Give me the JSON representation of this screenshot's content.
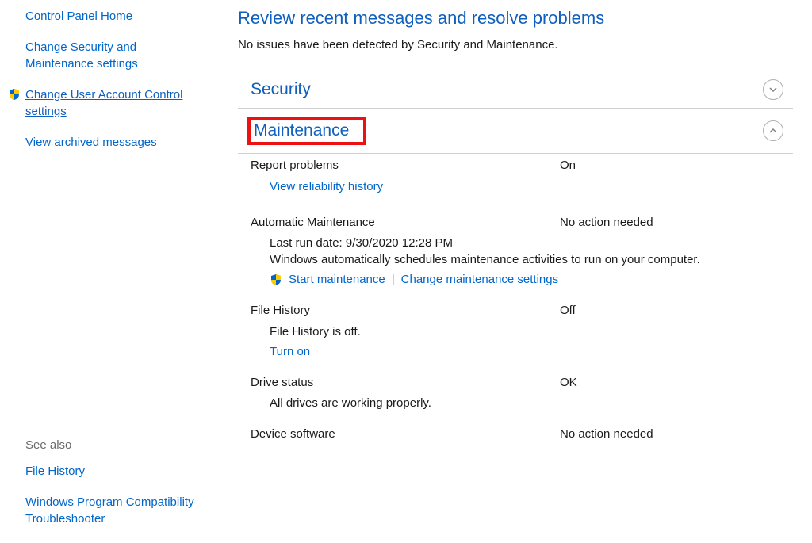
{
  "sidebar": {
    "home": "Control Panel Home",
    "change_security": "Change Security and Maintenance settings",
    "change_uac": "Change User Account Control settings",
    "view_archived": "View archived messages",
    "see_also": "See also",
    "file_history": "File History",
    "compat_troubleshooter": "Windows Program Compatibility Troubleshooter"
  },
  "main": {
    "title": "Review recent messages and resolve problems",
    "subtitle": "No issues have been detected by Security and Maintenance.",
    "security_section": "Security",
    "maintenance_section": "Maintenance",
    "report_problems": {
      "label": "Report problems",
      "value": "On",
      "link": "View reliability history"
    },
    "auto_maint": {
      "label": "Automatic Maintenance",
      "value": "No action needed",
      "last_run": "Last run date: 9/30/2020 12:28 PM",
      "desc": "Windows automatically schedules maintenance activities to run on your computer.",
      "start": "Start maintenance",
      "change": "Change maintenance settings"
    },
    "file_history": {
      "label": "File History",
      "value": "Off",
      "status": "File History is off.",
      "turn_on": "Turn on"
    },
    "drive_status": {
      "label": "Drive status",
      "value": "OK",
      "desc": "All drives are working properly."
    },
    "device_software": {
      "label": "Device software",
      "value": "No action needed"
    }
  }
}
